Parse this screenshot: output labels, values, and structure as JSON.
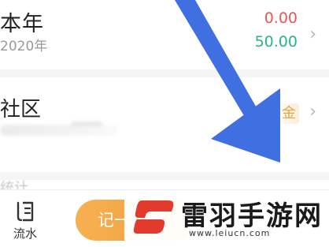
{
  "year_row": {
    "title": "本年",
    "subtitle": "2020年",
    "expense": "0.00",
    "income": "50.00",
    "chevron_icon": "chevron-right-icon",
    "expense_color": "#e05a5a",
    "income_color": "#2bb38a"
  },
  "community_row": {
    "title": "社区",
    "coin_text": "金",
    "chevron_icon": "chevron-right-icon",
    "coin_color": "#e2a74a"
  },
  "partial_label": "统计",
  "tabbar": {
    "flow_label": "流水",
    "flow_icon": "ledger-icon",
    "record_label": "记一",
    "record_color": "#f29b34"
  },
  "watermark": {
    "name": "雷羽手游网",
    "url": "www.leiucn.com",
    "accent": "#e23b2e"
  },
  "annotation": {
    "arrow_icon": "arrow-down-right-icon",
    "color": "#3f6fe0"
  }
}
